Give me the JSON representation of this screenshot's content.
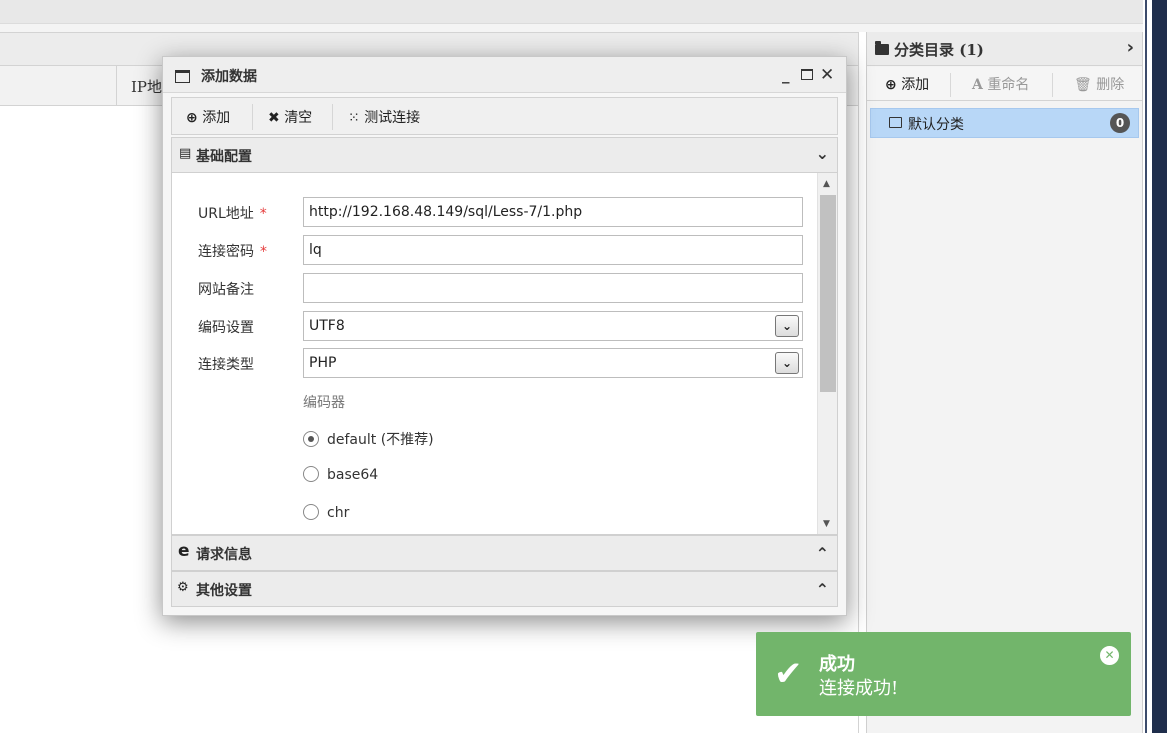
{
  "main_list": {
    "column_ip": "IP地"
  },
  "sidebar": {
    "title": "分类目录 (1)",
    "toolbar": {
      "add": "添加",
      "rename": "重命名",
      "delete": "删除"
    },
    "folders": [
      {
        "label": "默认分类",
        "count": "0"
      }
    ]
  },
  "dialog": {
    "title": "添加数据",
    "toolbar": {
      "add": "添加",
      "clear": "清空",
      "test": "测试连接"
    },
    "sections": {
      "basic": "基础配置",
      "request": "请求信息",
      "other": "其他设置"
    },
    "fields": {
      "url": {
        "label": "URL地址",
        "value": "http://192.168.48.149/sql/Less-7/1.php",
        "required": "*"
      },
      "password": {
        "label": "连接密码",
        "value": "lq",
        "required": "*"
      },
      "note": {
        "label": "网站备注",
        "value": ""
      },
      "encoding": {
        "label": "编码设置",
        "value": "UTF8"
      },
      "type": {
        "label": "连接类型",
        "value": "PHP"
      }
    },
    "encoder": {
      "label": "编码器",
      "options": [
        {
          "label": "default (不推荐)",
          "selected": true
        },
        {
          "label": "base64",
          "selected": false
        },
        {
          "label": "chr",
          "selected": false
        }
      ]
    }
  },
  "toast": {
    "title": "成功",
    "message": "连接成功!",
    "color": "#72b56b"
  }
}
